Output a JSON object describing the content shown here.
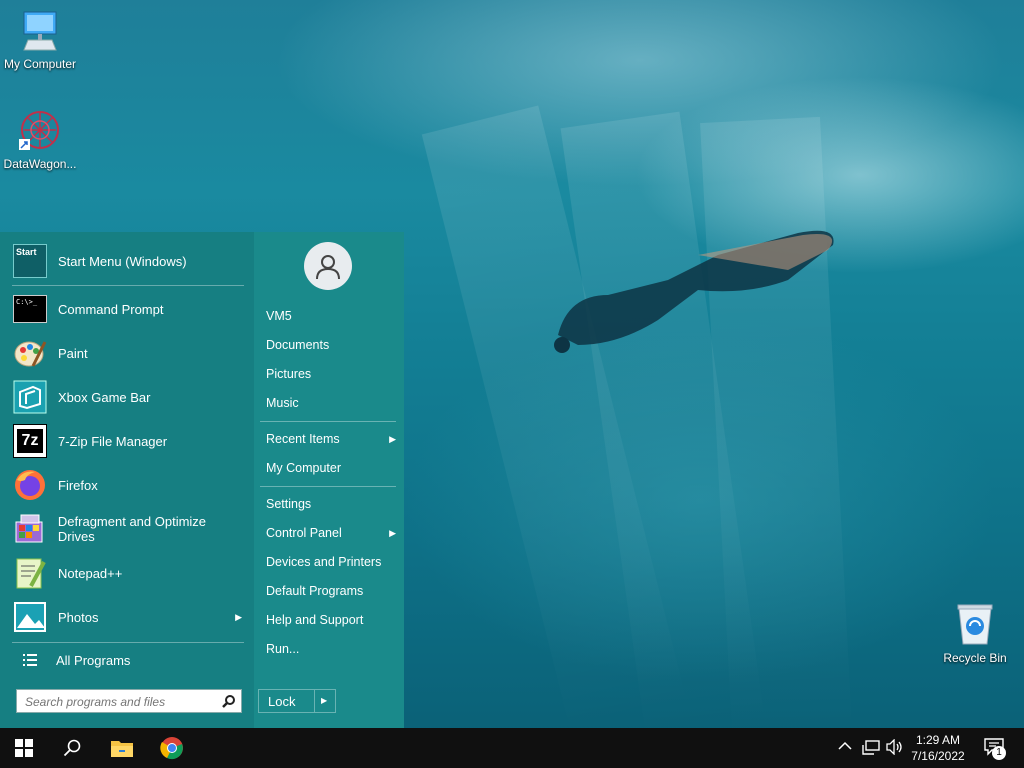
{
  "desktop": {
    "icons": [
      {
        "label": "My Computer"
      },
      {
        "label": "DataWagon..."
      },
      {
        "label": "Recycle Bin"
      }
    ]
  },
  "start_menu": {
    "programs": [
      {
        "label": "Start Menu (Windows)",
        "icon": "start-menu-icon"
      },
      {
        "label": "Command Prompt",
        "icon": "command-prompt-icon"
      },
      {
        "label": "Paint",
        "icon": "paint-icon"
      },
      {
        "label": "Xbox Game Bar",
        "icon": "xbox-game-bar-icon"
      },
      {
        "label": "7-Zip File Manager",
        "icon": "7zip-icon"
      },
      {
        "label": "Firefox",
        "icon": "firefox-icon"
      },
      {
        "label": "Defragment and Optimize Drives",
        "icon": "defrag-icon"
      },
      {
        "label": "Notepad++",
        "icon": "notepadpp-icon"
      },
      {
        "label": "Photos",
        "icon": "photos-icon"
      }
    ],
    "start_icon_text": "Start",
    "cmd_icon_text": "C:\\>_",
    "zip_icon_text": "7z",
    "all_programs": "All Programs",
    "search_placeholder": "Search programs and files",
    "right_items": [
      {
        "label": "VM5"
      },
      {
        "label": "Documents"
      },
      {
        "label": "Pictures"
      },
      {
        "label": "Music"
      },
      {
        "label": "Recent Items"
      },
      {
        "label": "My Computer"
      },
      {
        "label": "Settings"
      },
      {
        "label": "Control Panel"
      },
      {
        "label": "Devices and Printers"
      },
      {
        "label": "Default Programs"
      },
      {
        "label": "Help and Support"
      },
      {
        "label": "Run..."
      }
    ],
    "lock_label": "Lock"
  },
  "taskbar": {
    "time": "1:29 AM",
    "date": "7/16/2022",
    "notification_count": "1"
  },
  "colors": {
    "menu_left": "#167f82",
    "menu_right": "#1a8a8b",
    "taskbar": "#101010"
  }
}
